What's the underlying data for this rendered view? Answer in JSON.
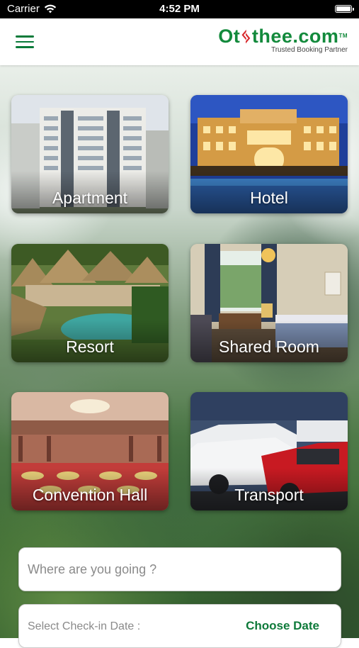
{
  "status_bar": {
    "carrier": "Carrier",
    "time": "4:52 PM"
  },
  "header": {
    "logo_part1": "Ot",
    "logo_part2": "thee.com",
    "logo_tm": "TM",
    "tagline": "Trusted Booking Partner"
  },
  "categories": [
    {
      "label": "Apartment"
    },
    {
      "label": "Hotel"
    },
    {
      "label": "Resort"
    },
    {
      "label": "Shared Room"
    },
    {
      "label": "Convention Hall"
    },
    {
      "label": "Transport"
    }
  ],
  "search": {
    "placeholder": "Where are you going ?"
  },
  "checkin": {
    "label": "Select Check-in Date :",
    "action": "Choose Date"
  },
  "colors": {
    "brand_green": "#138a3c",
    "brand_red": "#d8282c",
    "accent_green": "#0e7a3a"
  }
}
